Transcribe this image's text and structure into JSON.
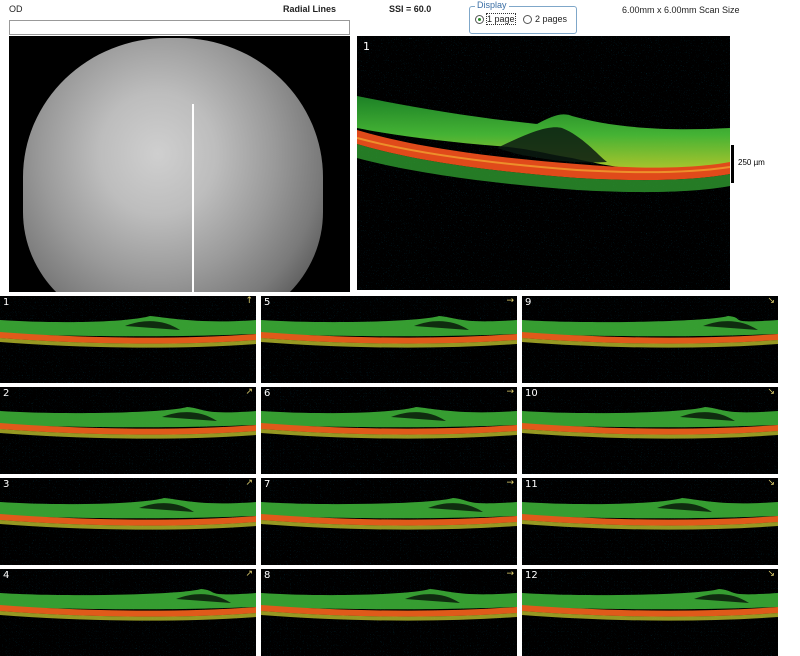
{
  "header": {
    "eye": "OD",
    "scan_type": "Radial Lines",
    "ssi": "SSI = 60.0",
    "scan_size": "6.00mm x 6.00mm Scan Size"
  },
  "display": {
    "legend": "Display",
    "options": [
      {
        "label": "1 page",
        "selected": true
      },
      {
        "label": "2 pages",
        "selected": false
      }
    ]
  },
  "main_scan": {
    "number": "1",
    "scale_label": "250 µm"
  },
  "thumbnails": [
    {
      "number": "1",
      "arrow": "↑"
    },
    {
      "number": "2",
      "arrow": "↗"
    },
    {
      "number": "3",
      "arrow": "↗"
    },
    {
      "number": "4",
      "arrow": "↗"
    },
    {
      "number": "5",
      "arrow": "→"
    },
    {
      "number": "6",
      "arrow": "→"
    },
    {
      "number": "7",
      "arrow": "→"
    },
    {
      "number": "8",
      "arrow": "→"
    },
    {
      "number": "9",
      "arrow": "↘"
    },
    {
      "number": "10",
      "arrow": "↘"
    },
    {
      "number": "11",
      "arrow": "↘"
    },
    {
      "number": "12",
      "arrow": "↘"
    }
  ],
  "colors": {
    "retina_green": "#3fc23a",
    "retina_yellow": "#d8e030",
    "rpe_red": "#e04a1a",
    "rpe_orange": "#f08a20",
    "background": "#000000"
  }
}
